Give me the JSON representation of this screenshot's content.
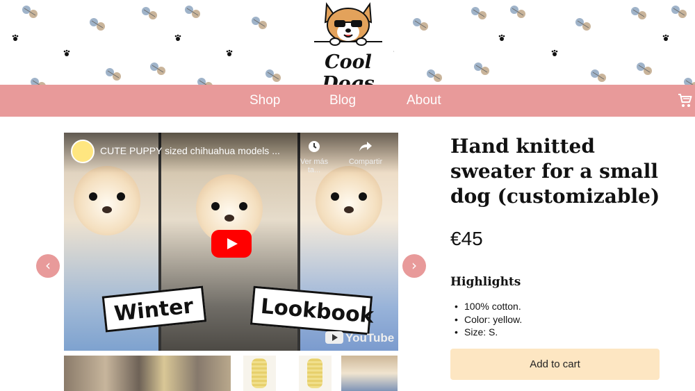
{
  "brand": {
    "name": "Cool Dogs"
  },
  "nav": {
    "items": [
      "Shop",
      "Blog",
      "About"
    ],
    "cart_icon": "cart-icon"
  },
  "video": {
    "title": "CUTE PUPPY sized chihuahua models ...",
    "watch_later": "Ver más ta...",
    "share": "Compartir",
    "sign_left": "Winter",
    "sign_right": "Lookbook",
    "platform": "YouTube"
  },
  "carousel": {
    "prev_icon": "chevron-left-icon",
    "next_icon": "chevron-right-icon",
    "prev": "‹",
    "next": "›"
  },
  "product": {
    "title": "Hand knitted sweater for a small dog (customizable)",
    "price": "€45",
    "highlights_heading": "Highlights",
    "highlights": [
      "100% cotton.",
      "Color: yellow.",
      "Size: S."
    ],
    "add_to_cart": "Add to cart"
  },
  "colors": {
    "nav_bg": "#e89a9a",
    "button_bg": "#fde6c2",
    "accent_red": "#ff0000"
  }
}
